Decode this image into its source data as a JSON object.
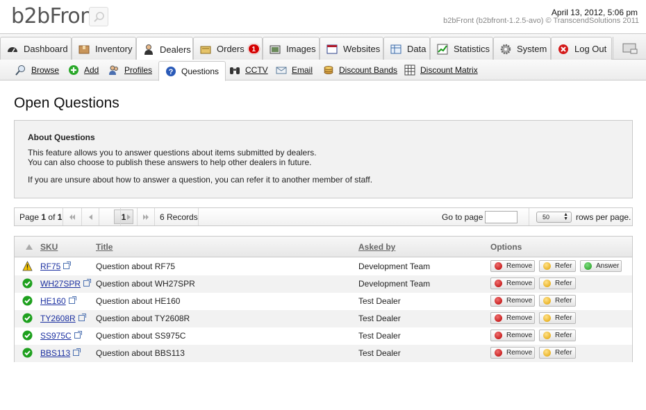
{
  "header": {
    "logo": "b2bFront",
    "date": "April 13, 2012, 5:06 pm",
    "version": "b2bFront (b2bfront-1.2.5-avo) © TranscendSolutions 2011"
  },
  "mainnav": [
    {
      "label": "Dashboard",
      "icon": "dashboard-icon"
    },
    {
      "label": "Inventory",
      "icon": "box-icon"
    },
    {
      "label": "Dealers",
      "icon": "user-icon"
    },
    {
      "label": "Orders",
      "icon": "orders-icon",
      "badge": "1"
    },
    {
      "label": "Images",
      "icon": "images-icon"
    },
    {
      "label": "Websites",
      "icon": "websites-icon"
    },
    {
      "label": "Data",
      "icon": "data-icon"
    },
    {
      "label": "Statistics",
      "icon": "chart-icon"
    },
    {
      "label": "System",
      "icon": "gear-icon"
    },
    {
      "label": "Log Out",
      "icon": "logout-icon"
    }
  ],
  "subnav": [
    {
      "label": "Browse",
      "icon": "search-icon"
    },
    {
      "label": "Add",
      "icon": "add-icon"
    },
    {
      "label": "Profiles",
      "icon": "profiles-icon"
    },
    {
      "label": "Questions",
      "icon": "question-icon"
    },
    {
      "label": "CCTV",
      "icon": "binoculars-icon"
    },
    {
      "label": "Email",
      "icon": "email-icon"
    },
    {
      "label": "Discount Bands",
      "icon": "coins-icon"
    },
    {
      "label": "Discount Matrix",
      "icon": "grid-icon"
    }
  ],
  "page_title": "Open Questions",
  "about": {
    "heading": "About Questions",
    "line1": "This feature allows you to answer questions about items submitted by dealers.",
    "line2": "You can also choose to publish these answers to help other dealers in future.",
    "line3": "If you are unsure about how to answer a question, you can refer it to another member of staff."
  },
  "pager": {
    "page_prefix": "Page",
    "current": "1",
    "of": "of",
    "total": "1",
    "page_button": "1",
    "records": "6 Records",
    "goto_label": "Go to page",
    "goto_value": "",
    "rows_value": "50",
    "rows_label": "rows per page."
  },
  "table": {
    "columns": {
      "sku": "SKU",
      "title": "Title",
      "asked_by": "Asked by",
      "options": "Options"
    },
    "buttons": {
      "remove": "Remove",
      "refer": "Refer",
      "answer": "Answer"
    },
    "rows": [
      {
        "status": "warning",
        "sku": "RF75",
        "title": "Question about RF75",
        "asked_by": "Development Team",
        "answer": true
      },
      {
        "status": "ok",
        "sku": "WH27SPR",
        "title": "Question about WH27SPR",
        "asked_by": "Development Team",
        "answer": false
      },
      {
        "status": "ok",
        "sku": "HE160",
        "title": "Question about HE160",
        "asked_by": "Test Dealer",
        "answer": false
      },
      {
        "status": "ok",
        "sku": "TY2608R",
        "title": "Question about TY2608R",
        "asked_by": "Test Dealer",
        "answer": false
      },
      {
        "status": "ok",
        "sku": "SS975C",
        "title": "Question about SS975C",
        "asked_by": "Test Dealer",
        "answer": false
      },
      {
        "status": "ok",
        "sku": "BBS113",
        "title": "Question about BBS113",
        "asked_by": "Test Dealer",
        "answer": false
      }
    ]
  }
}
